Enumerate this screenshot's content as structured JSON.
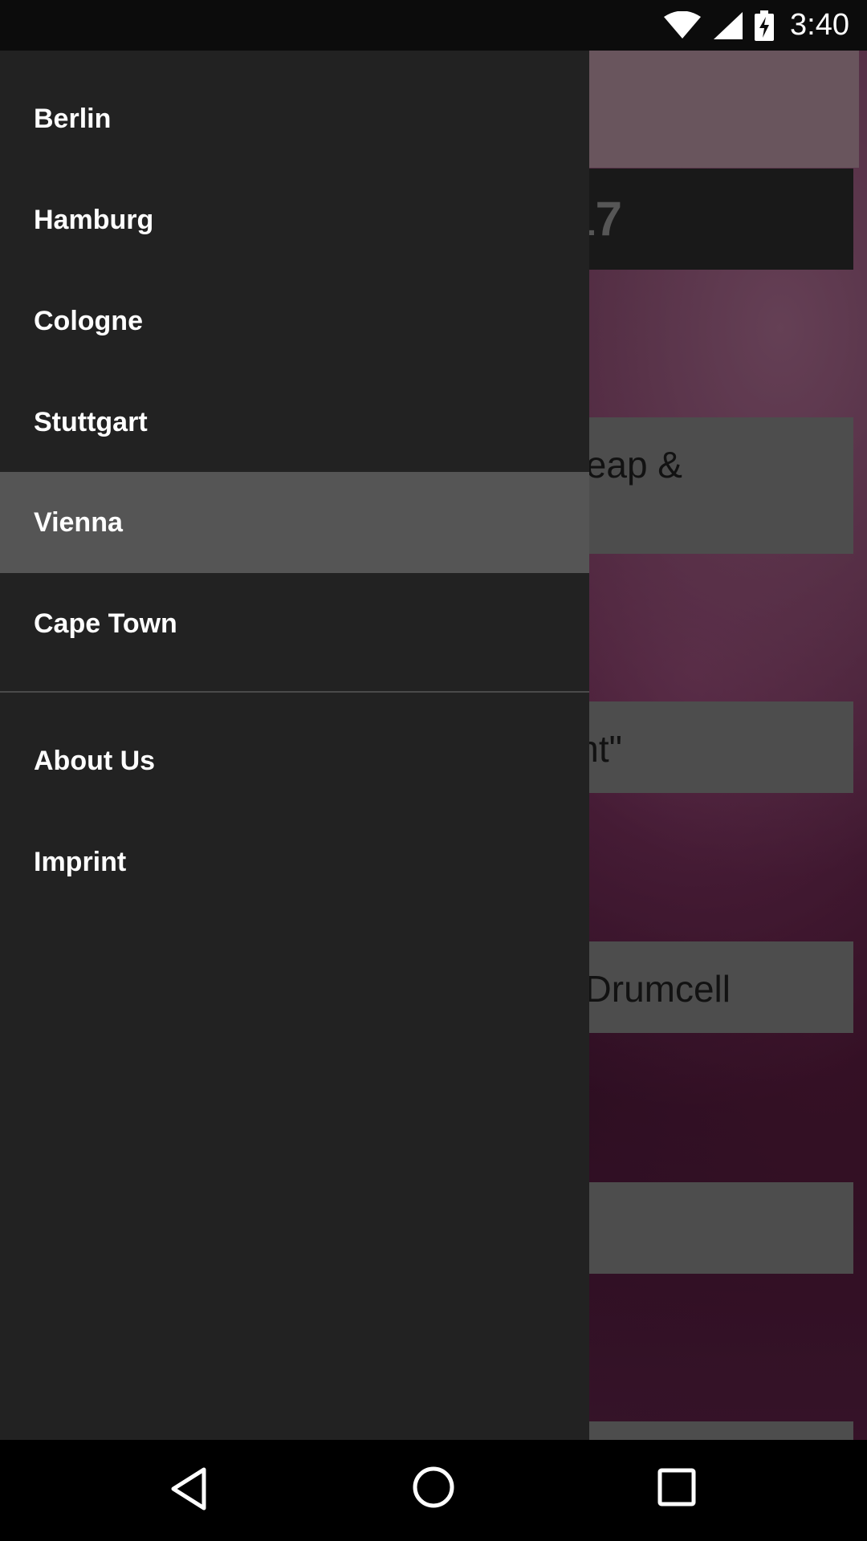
{
  "status_bar": {
    "time": "3:40",
    "icons": [
      "wifi-icon",
      "cell-signal-icon",
      "battery-charging-icon"
    ]
  },
  "background_content": {
    "cards": [
      {
        "text": "17"
      },
      {
        "text": "eap &"
      },
      {
        "text": "nt\""
      },
      {
        "text": "Drumcell"
      },
      {
        "text": ""
      },
      {
        "text": ""
      }
    ]
  },
  "drawer": {
    "cities": [
      {
        "label": "Berlin"
      },
      {
        "label": "Hamburg"
      },
      {
        "label": "Cologne"
      },
      {
        "label": "Stuttgart"
      },
      {
        "label": "Vienna",
        "selected": true
      },
      {
        "label": "Cape Town"
      }
    ],
    "secondary": [
      {
        "label": "About Us"
      },
      {
        "label": "Imprint"
      }
    ]
  },
  "nav_bar": {
    "icons": [
      "back-icon",
      "home-icon",
      "recents-icon"
    ]
  },
  "colors": {
    "drawer_bg": "#222222",
    "selected_bg": "#555555"
  }
}
